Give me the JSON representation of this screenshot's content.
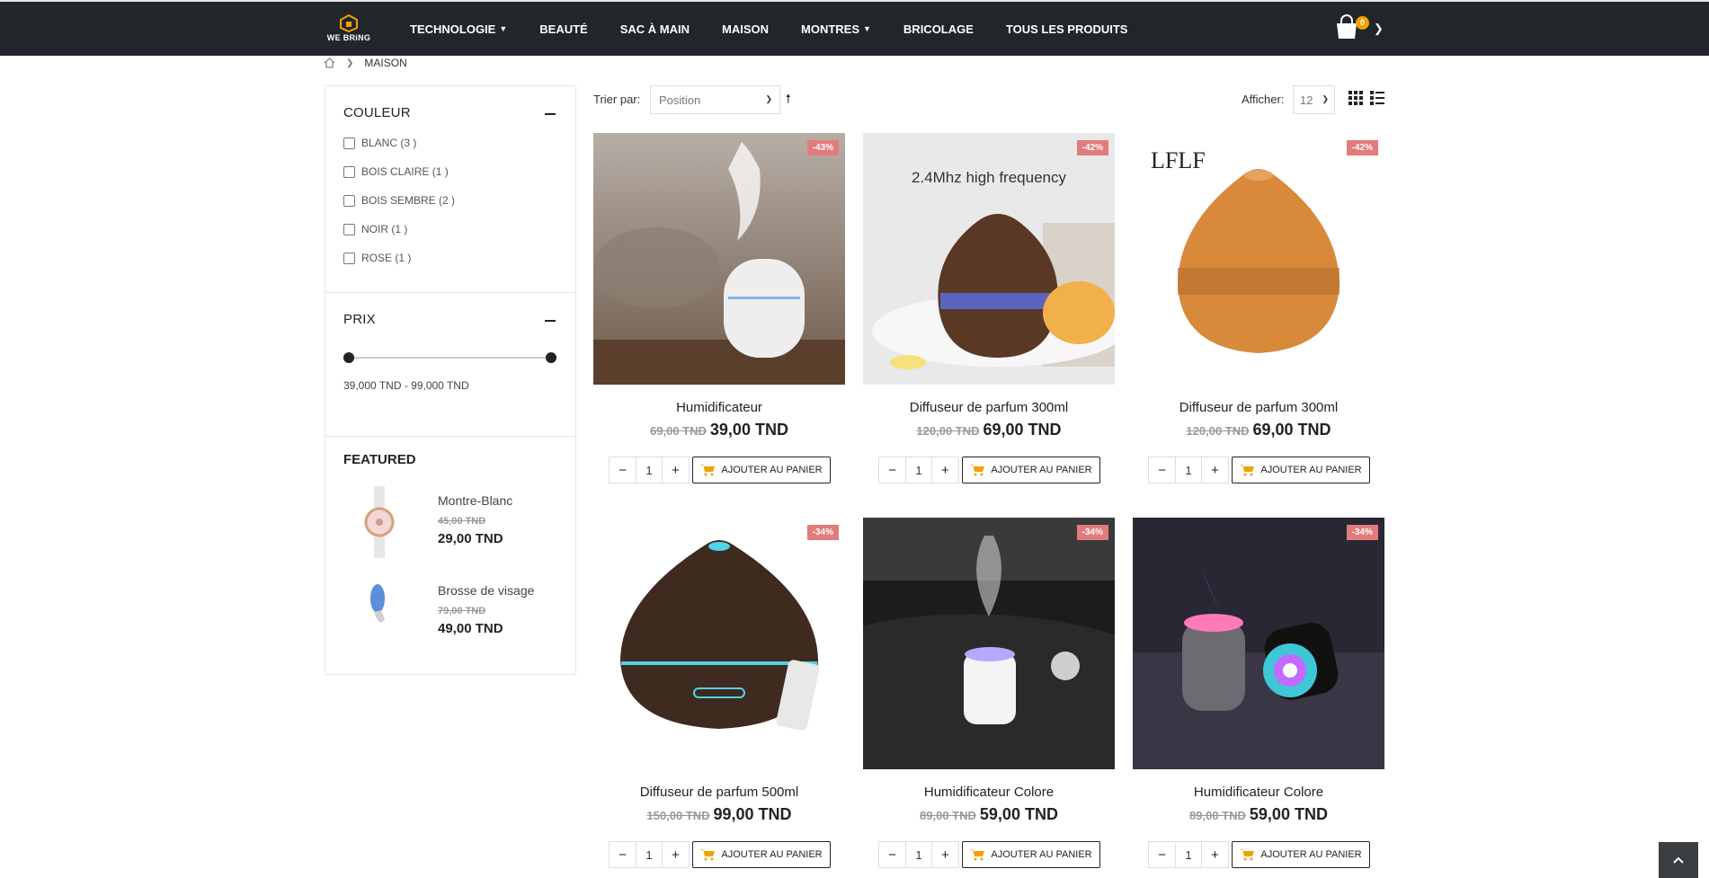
{
  "brand": {
    "logo_text": "WE BRiNG",
    "accent": "#f4a100",
    "header_bg": "#222529",
    "sale_badge_bg": "#e27c7c"
  },
  "nav": {
    "items": [
      {
        "label": "TECHNOLOGIE",
        "has_dropdown": true
      },
      {
        "label": "BEAUTÉ",
        "has_dropdown": false
      },
      {
        "label": "SAC À MAIN",
        "has_dropdown": false
      },
      {
        "label": "MAISON",
        "has_dropdown": false
      },
      {
        "label": "MONTRES",
        "has_dropdown": true
      },
      {
        "label": "BRICOLAGE",
        "has_dropdown": false
      },
      {
        "label": "TOUS LES PRODUITS",
        "has_dropdown": false
      }
    ],
    "cart_count": "0"
  },
  "breadcrumb": {
    "home_icon": "home-icon",
    "current": "MAISON"
  },
  "filters": {
    "color_title": "COULEUR",
    "colors": [
      "BLANC (3 )",
      "BOIS CLAIRE (1 )",
      "BOIS SEMBRE (2 )",
      "NOIR (1 )",
      "ROSE (1 )"
    ],
    "price_title": "PRIX",
    "price_min": 39,
    "price_max": 99,
    "price_range_text": "39,000 TND - 99,000 TND"
  },
  "featured": {
    "title": "FEATURED",
    "items": [
      {
        "name": "Montre-Blanc",
        "old_price": "45,00 TND",
        "price": "29,00 TND"
      },
      {
        "name": "Brosse de visage",
        "old_price": "79,00 TND",
        "price": "49,00 TND"
      }
    ]
  },
  "toolbar": {
    "sort_label": "Trier par:",
    "sort_value": "Position",
    "show_label": "Afficher:",
    "show_value": "12"
  },
  "products": [
    {
      "name": "Humidificateur",
      "discount": "-43%",
      "old_price": "69,00 TND",
      "price": "39,00 TND",
      "qty": "1",
      "add_label": "AJOUTER AU PANIER"
    },
    {
      "name": "Diffuseur de parfum 300ml",
      "discount": "-42%",
      "old_price": "120,00 TND",
      "price": "69,00 TND",
      "qty": "1",
      "add_label": "AJOUTER AU PANIER",
      "image_text": "2.4Mhz high frequency"
    },
    {
      "name": "Diffuseur de parfum 300ml",
      "discount": "-42%",
      "old_price": "120,00 TND",
      "price": "69,00 TND",
      "qty": "1",
      "add_label": "AJOUTER AU PANIER",
      "image_text": "LFLF"
    },
    {
      "name": "Diffuseur de parfum 500ml",
      "discount": "-34%",
      "old_price": "150,00 TND",
      "price": "99,00 TND",
      "qty": "1",
      "add_label": "AJOUTER AU PANIER"
    },
    {
      "name": "Humidificateur Colore",
      "discount": "-34%",
      "old_price": "89,00 TND",
      "price": "59,00 TND",
      "qty": "1",
      "add_label": "AJOUTER AU PANIER"
    },
    {
      "name": "Humidificateur Colore",
      "discount": "-34%",
      "old_price": "89,00 TND",
      "price": "59,00 TND",
      "qty": "1",
      "add_label": "AJOUTER AU PANIER"
    }
  ]
}
